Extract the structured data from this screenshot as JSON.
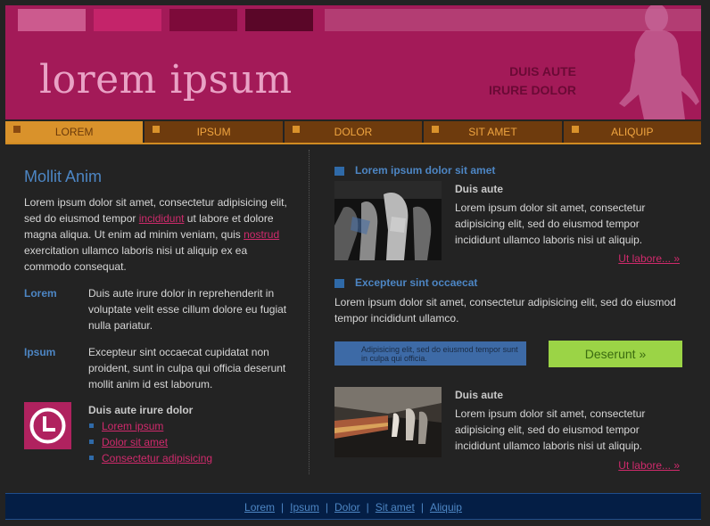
{
  "header": {
    "logo_text": "lorem ipsum",
    "tagline_line1": "DUIS AUTE",
    "tagline_line2": "IRURE DOLOR"
  },
  "nav": {
    "items": [
      {
        "label": "LOREM",
        "active": true
      },
      {
        "label": "IPSUM",
        "active": false
      },
      {
        "label": "DOLOR",
        "active": false
      },
      {
        "label": "SIT AMET",
        "active": false
      },
      {
        "label": "ALIQUIP",
        "active": false
      }
    ]
  },
  "left": {
    "heading": "Mollit Anim",
    "intro_part1": "Lorem ipsum dolor sit amet, consectetur adipisicing elit, sed do eiusmod tempor ",
    "intro_link1": "incididunt",
    "intro_part2": " ut labore et dolore magna aliqua. Ut enim ad minim veniam, quis ",
    "intro_link2": "nostrud",
    "intro_part3": " exercitation ullamco laboris nisi ut aliquip ex ea commodo consequat.",
    "defs": [
      {
        "term": "Lorem",
        "desc": "Duis aute irure dolor in reprehenderit in voluptate velit esse cillum dolore eu fugiat nulla pariatur."
      },
      {
        "term": "Ipsum",
        "desc": "Excepteur sint occaecat cupidatat non proident, sunt in culpa qui officia deserunt mollit anim id est laborum."
      }
    ],
    "links_title": "Duis aute irure dolor",
    "links": [
      "Lorem ipsum",
      "Dolor sit amet",
      "Consectetur adipisicing"
    ],
    "icon": "clock-icon"
  },
  "right": {
    "section1_title": "Lorem ipsum dolor sit amet",
    "story1": {
      "title": "Duis aute",
      "text": "Lorem ipsum dolor sit amet, consectetur adipisicing elit, sed do eiusmod tempor incididunt ullamco laboris nisi ut aliquip.",
      "more": "Ut labore... »"
    },
    "section2_title": "Excepteur sint occaecat",
    "section2_text": "Lorem ipsum dolor sit amet, consectetur adipisicing elit, sed do eiusmod tempor incididunt ullamco.",
    "note": "Adipisicing elit, sed do eiusmod tempor sunt in culpa qui officia.",
    "cta": "Deserunt »",
    "story2": {
      "title": "Duis aute",
      "text": "Lorem ipsum dolor sit amet, consectetur adipisicing elit, sed do eiusmod tempor incididunt ullamco laboris nisi ut aliquip.",
      "more": "Ut labore... »"
    }
  },
  "footer": {
    "links": [
      "Lorem",
      "Ipsum",
      "Dolor",
      "Sit amet",
      "Aliquip"
    ],
    "separator": "|"
  },
  "colors": {
    "header_bg": "#a31a58",
    "nav_bg": "#6e3b0d",
    "nav_active": "#d9922b",
    "accent_blue": "#4d86c4",
    "link_pink": "#d02a6c",
    "cta_green": "#9bd446",
    "footer_bg": "#041e45"
  }
}
